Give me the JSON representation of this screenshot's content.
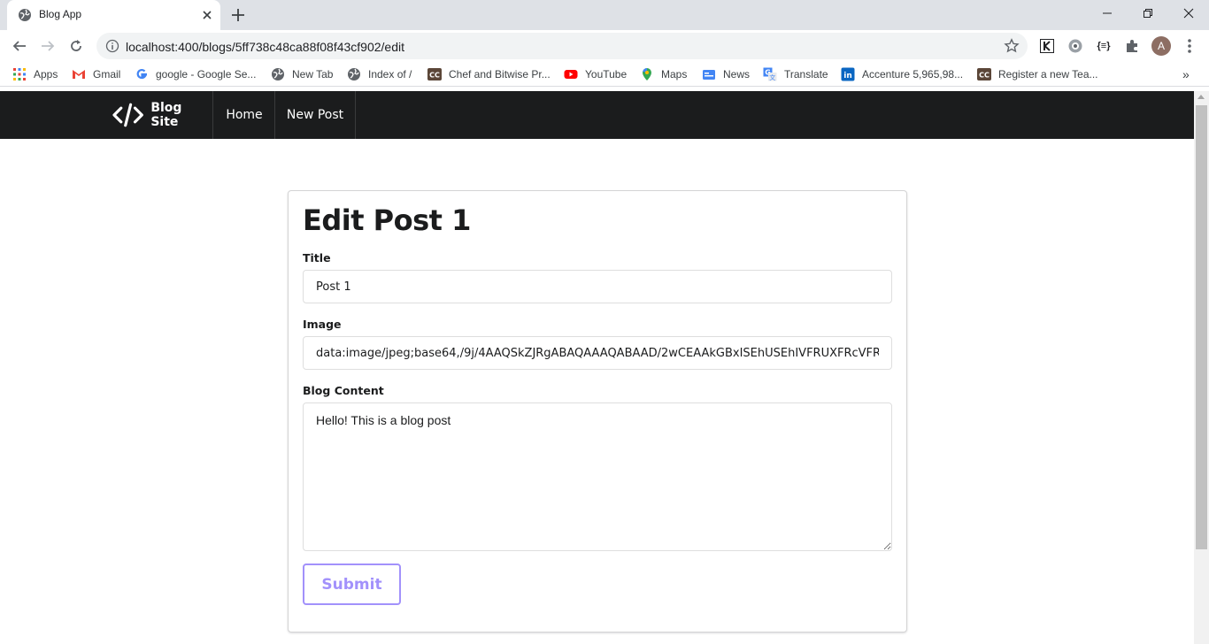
{
  "browser": {
    "tab_title": "Blog App",
    "url": "localhost:400/blogs/5ff738c48ca88f08f43cf902/edit",
    "avatar_letter": "A",
    "bookmarks": [
      {
        "label": "Apps",
        "icon": "apps-grid-icon"
      },
      {
        "label": "Gmail",
        "icon": "gmail-icon"
      },
      {
        "label": "google - Google Se...",
        "icon": "google-icon"
      },
      {
        "label": "New Tab",
        "icon": "globe-icon"
      },
      {
        "label": "Index of /",
        "icon": "globe-icon"
      },
      {
        "label": "Chef and Bitwise Pr...",
        "icon": "codechef-icon"
      },
      {
        "label": "YouTube",
        "icon": "youtube-icon"
      },
      {
        "label": "Maps",
        "icon": "maps-icon"
      },
      {
        "label": "News",
        "icon": "news-icon"
      },
      {
        "label": "Translate",
        "icon": "translate-icon"
      },
      {
        "label": "Accenture 5,965,98...",
        "icon": "linkedin-icon"
      },
      {
        "label": "Register a new Tea...",
        "icon": "codechef-icon"
      }
    ]
  },
  "navbar": {
    "brand": "Blog Site",
    "items": [
      "Home",
      "New Post"
    ]
  },
  "form": {
    "heading": "Edit Post 1",
    "title_label": "Title",
    "title_value": "Post 1",
    "image_label": "Image",
    "image_value": "data:image/jpeg;base64,/9j/4AAQSkZJRgABAQAAAQABAAD/2wCEAAkGBxISEhUSEhIVFRUXFRcVFR",
    "content_label": "Blog Content",
    "content_value": "Hello! This is a blog post",
    "submit_label": "Submit"
  },
  "colors": {
    "navbar_bg": "#1b1c1d",
    "accent": "#a291fb"
  }
}
